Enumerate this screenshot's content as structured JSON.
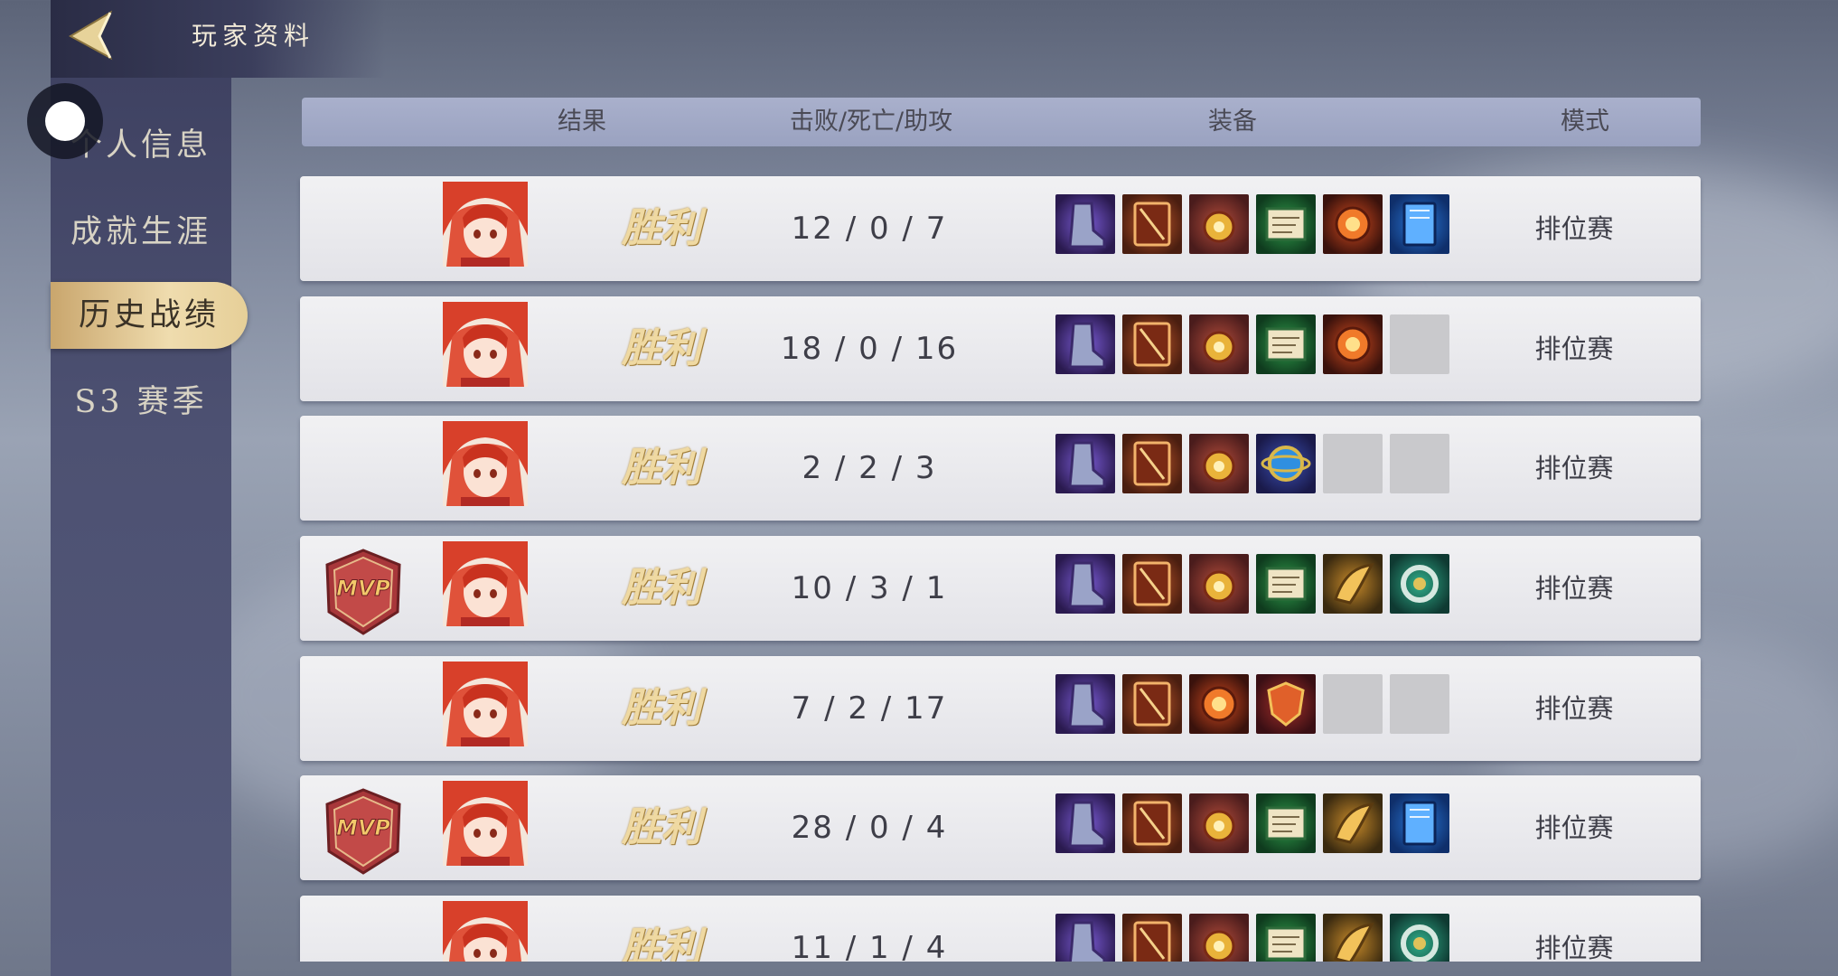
{
  "header": {
    "title": "玩家资料",
    "back_icon": "back-arrow-icon"
  },
  "sidebar": {
    "items": [
      {
        "label": "个人信息",
        "active": false
      },
      {
        "label": "成就生涯",
        "active": false
      },
      {
        "label": "历史战绩",
        "active": true
      },
      {
        "label": "S3 赛季",
        "active": false
      }
    ]
  },
  "table": {
    "columns": [
      "结果",
      "击败/死亡/助攻",
      "装备",
      "模式"
    ],
    "rows": [
      {
        "mvp": false,
        "result": "胜利",
        "kda": "12 / 0 /  7",
        "mode": "排位赛",
        "items": [
          "boots-item",
          "tome-item",
          "orb-item",
          "scroll-item",
          "fire-orb-item",
          "book-item"
        ]
      },
      {
        "mvp": false,
        "result": "胜利",
        "kda": "18 / 0 / 16",
        "mode": "排位赛",
        "items": [
          "boots-item",
          "tome-item",
          "orb-item",
          "scroll-item",
          "fire-orb-item",
          "empty"
        ]
      },
      {
        "mvp": false,
        "result": "胜利",
        "kda": " 2 / 2 /  3",
        "mode": "排位赛",
        "items": [
          "boots-item",
          "tome-item",
          "orb-item",
          "globe-item",
          "empty",
          "empty"
        ]
      },
      {
        "mvp": true,
        "mvp_label": "MVP",
        "result": "胜利",
        "kda": "10 / 3 /  1",
        "mode": "排位赛",
        "items": [
          "boots-item",
          "tome-item",
          "orb-item",
          "scroll-item",
          "claw-item",
          "ring-item"
        ]
      },
      {
        "mvp": false,
        "result": "胜利",
        "kda": " 7 / 2 / 17",
        "mode": "排位赛",
        "items": [
          "boots-item",
          "tome-item",
          "fire-orb-item",
          "shield-item",
          "empty",
          "empty"
        ]
      },
      {
        "mvp": true,
        "mvp_label": "MVP",
        "result": "胜利",
        "kda": "28 / 0 /  4",
        "mode": "排位赛",
        "items": [
          "boots-item",
          "tome-item",
          "orb-item",
          "scroll-item",
          "claw-item",
          "book-item"
        ]
      },
      {
        "mvp": false,
        "result": "胜利",
        "kda": "11 / 1 /  4",
        "mode": "排位赛",
        "items": [
          "boots-item",
          "tome-item",
          "orb-item",
          "scroll-item",
          "claw-item",
          "ring-item"
        ]
      }
    ]
  },
  "colors": {
    "accent_gold": "#efd9a2",
    "active_tab": "#e6cf98",
    "row_bg": "#eaeaee",
    "mvp_red": "#a8373a"
  }
}
